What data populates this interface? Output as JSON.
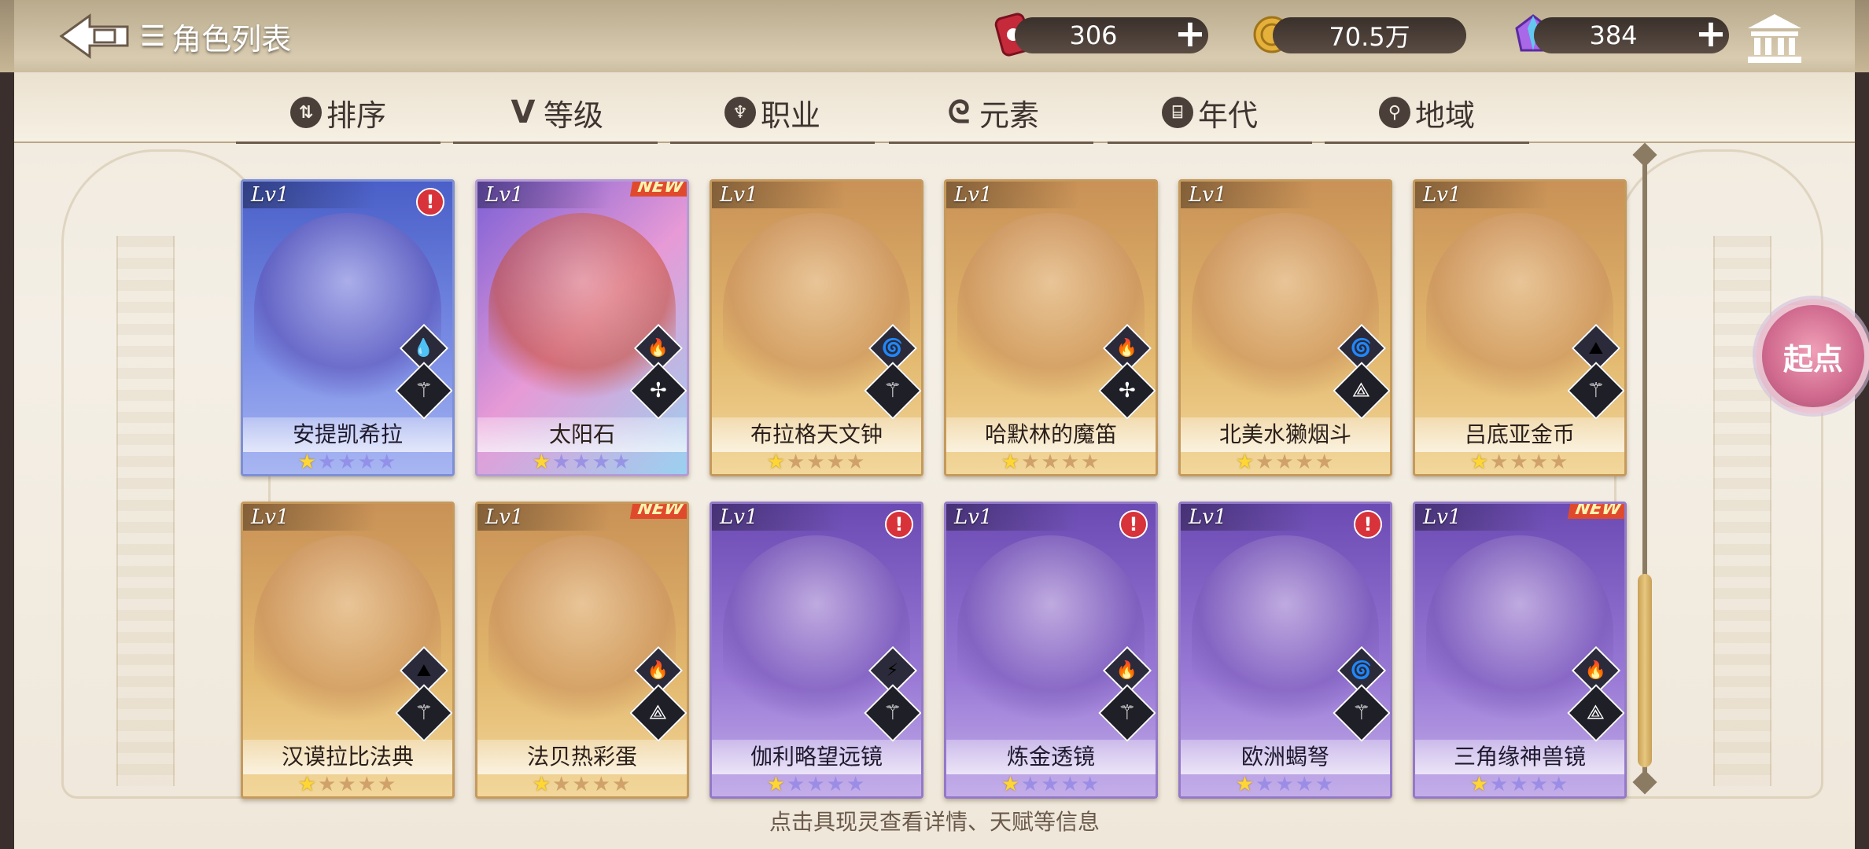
{
  "header": {
    "title": "角色列表",
    "resources": [
      {
        "name": "ticket",
        "value": "306"
      },
      {
        "name": "coin",
        "value": "70.5万"
      },
      {
        "name": "crystal",
        "value": "384"
      }
    ],
    "plus_label": "+"
  },
  "filters": [
    {
      "label": "排序",
      "icon": "sort-icon",
      "glyph": "⇅"
    },
    {
      "label": "等级",
      "icon": "level-icon",
      "glyph": "V"
    },
    {
      "label": "职业",
      "icon": "job-icon",
      "glyph": "♆"
    },
    {
      "label": "元素",
      "icon": "element-icon",
      "glyph": "ᘓ"
    },
    {
      "label": "年代",
      "icon": "era-icon",
      "glyph": "⌸"
    },
    {
      "label": "地域",
      "icon": "region-icon",
      "glyph": "⚲"
    }
  ],
  "cards": [
    {
      "name": "安提凯希拉",
      "lv": "Lv1",
      "rarity": "blue",
      "badge": "alert",
      "element": "water-icon",
      "element_glyph": "💧",
      "job": "tank-icon",
      "job_glyph": "⚚",
      "stars": 1
    },
    {
      "name": "太阳石",
      "lv": "Lv1",
      "rarity": "rainbow",
      "badge": "NEW",
      "element": "fire-icon",
      "element_glyph": "🔥",
      "job": "healer-icon",
      "job_glyph": "✢",
      "stars": 1
    },
    {
      "name": "布拉格天文钟",
      "lv": "Lv1",
      "rarity": "gold",
      "badge": "",
      "element": "wind-icon",
      "element_glyph": "🌀",
      "job": "tank-icon",
      "job_glyph": "⚚",
      "stars": 1
    },
    {
      "name": "哈默林的魔笛",
      "lv": "Lv1",
      "rarity": "gold",
      "badge": "",
      "element": "fire-icon",
      "element_glyph": "🔥",
      "job": "healer-icon",
      "job_glyph": "✢",
      "stars": 1
    },
    {
      "name": "北美水獭烟斗",
      "lv": "Lv1",
      "rarity": "gold",
      "badge": "",
      "element": "wind-icon",
      "element_glyph": "🌀",
      "job": "support-icon",
      "job_glyph": "⟁",
      "stars": 1
    },
    {
      "name": "吕底亚金币",
      "lv": "Lv1",
      "rarity": "gold",
      "badge": "",
      "element": "earth-icon",
      "element_glyph": "⛰",
      "job": "tank-icon",
      "job_glyph": "⚚",
      "stars": 1
    },
    {
      "name": "汉谟拉比法典",
      "lv": "Lv1",
      "rarity": "gold",
      "badge": "",
      "element": "earth-icon",
      "element_glyph": "⛰",
      "job": "tank-icon",
      "job_glyph": "⚚",
      "stars": 1
    },
    {
      "name": "法贝热彩蛋",
      "lv": "Lv1",
      "rarity": "gold",
      "badge": "NEW",
      "element": "fire-icon",
      "element_glyph": "🔥",
      "job": "support-icon",
      "job_glyph": "⟁",
      "stars": 1
    },
    {
      "name": "伽利略望远镜",
      "lv": "Lv1",
      "rarity": "purple",
      "badge": "alert",
      "element": "thunder-icon",
      "element_glyph": "⚡",
      "job": "tank-icon",
      "job_glyph": "⚚",
      "stars": 1
    },
    {
      "name": "炼金透镜",
      "lv": "Lv1",
      "rarity": "purple",
      "badge": "alert",
      "element": "fire-icon",
      "element_glyph": "🔥",
      "job": "tank-icon",
      "job_glyph": "⚚",
      "stars": 1
    },
    {
      "name": "欧洲蝎弩",
      "lv": "Lv1",
      "rarity": "purple",
      "badge": "alert",
      "element": "wind-icon",
      "element_glyph": "🌀",
      "job": "tank-icon",
      "job_glyph": "⚚",
      "stars": 1
    },
    {
      "name": "三角缘神兽镜",
      "lv": "Lv1",
      "rarity": "purple",
      "badge": "NEW",
      "element": "fire-icon",
      "element_glyph": "🔥",
      "job": "support-icon",
      "job_glyph": "⟁",
      "stars": 1
    }
  ],
  "start_button": "起点",
  "hint": "点击具现灵查看详情、天赋等信息",
  "colors": {
    "gold": "#e3b96f",
    "blue": "#7c8fe6",
    "purple": "#9a7ad6",
    "alert": "#d8323a",
    "star": "#ffd633"
  }
}
